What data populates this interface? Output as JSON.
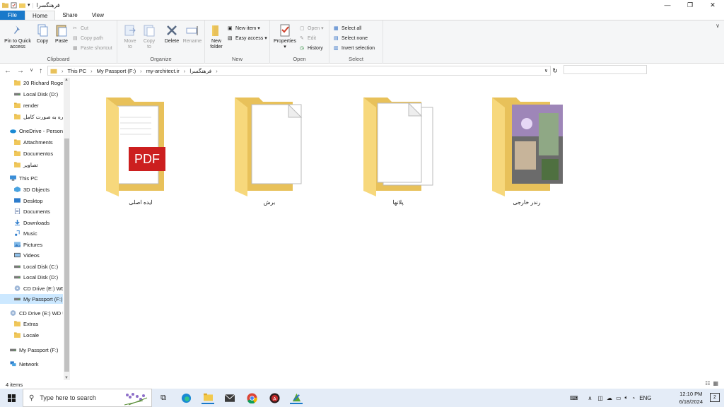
{
  "window": {
    "title": "فرهنگسرا",
    "controls": {
      "minimize": "—",
      "maximize": "❐",
      "close": "✕"
    }
  },
  "ribbon_tabs": [
    "File",
    "Home",
    "Share",
    "View"
  ],
  "ribbon": {
    "clipboard": {
      "label": "Clipboard",
      "pin": "Pin to Quick access",
      "copy": "Copy",
      "paste": "Paste",
      "cut": "Cut",
      "copy_path": "Copy path",
      "paste_shortcut": "Paste shortcut"
    },
    "organize": {
      "label": "Organize",
      "move_to": "Move to",
      "copy_to": "Copy to",
      "delete": "Delete",
      "rename": "Rename"
    },
    "new": {
      "label": "New",
      "new_folder": "New folder",
      "new_item": "New item",
      "easy_access": "Easy access"
    },
    "open": {
      "label": "Open",
      "properties": "Properties",
      "open": "Open",
      "edit": "Edit",
      "history": "History"
    },
    "select": {
      "label": "Select",
      "select_all": "Select all",
      "select_none": "Select none",
      "invert": "Invert selection"
    }
  },
  "address": {
    "crumbs": [
      "This PC",
      "My Passport (F:)",
      "my-architect.ir",
      "فرهنگسرا"
    ]
  },
  "navpane": [
    {
      "label": "20 Richard Roge",
      "icon": "folder"
    },
    {
      "label": "Local Disk (D:)",
      "icon": "drive"
    },
    {
      "label": "render",
      "icon": "folder"
    },
    {
      "label": "ره به صورت کامل",
      "icon": "folder"
    },
    {
      "label": "OneDrive - Person",
      "icon": "cloud"
    },
    {
      "label": "Attachments",
      "icon": "folder"
    },
    {
      "label": "Documentos",
      "icon": "folder"
    },
    {
      "label": "تصاویر",
      "icon": "folder"
    },
    {
      "label": "This PC",
      "icon": "pc"
    },
    {
      "label": "3D Objects",
      "icon": "3d"
    },
    {
      "label": "Desktop",
      "icon": "desktop"
    },
    {
      "label": "Documents",
      "icon": "docs"
    },
    {
      "label": "Downloads",
      "icon": "download"
    },
    {
      "label": "Music",
      "icon": "music"
    },
    {
      "label": "Pictures",
      "icon": "pictures"
    },
    {
      "label": "Videos",
      "icon": "videos"
    },
    {
      "label": "Local Disk (C:)",
      "icon": "drive"
    },
    {
      "label": "Local Disk (D:)",
      "icon": "drive"
    },
    {
      "label": "CD Drive (E:) WD",
      "icon": "cd"
    },
    {
      "label": "My Passport (F:)",
      "icon": "drive",
      "selected": true
    },
    {
      "label": "CD Drive (E:) WD U",
      "icon": "cd"
    },
    {
      "label": "Extras",
      "icon": "folder"
    },
    {
      "label": "Locale",
      "icon": "folder"
    },
    {
      "label": "My Passport (F:)",
      "icon": "drive"
    },
    {
      "label": "Network",
      "icon": "network"
    }
  ],
  "folders": [
    {
      "name": "ایده اصلی",
      "preview": "pdf"
    },
    {
      "name": "برش",
      "preview": "blank"
    },
    {
      "name": "پلانها",
      "preview": "docs"
    },
    {
      "name": "رندر خارجی",
      "preview": "render"
    }
  ],
  "status": {
    "items": "4 items"
  },
  "taskbar": {
    "search_placeholder": "Type here to search",
    "lang": "ENG",
    "time": "12:10 PM",
    "date": "6/18/2024",
    "notifications": "2"
  },
  "colors": {
    "accent": "#1979ca",
    "folder_back": "#e8c15a",
    "folder_front": "#f7d87c",
    "selected": "#cce8ff",
    "taskbar": "#e4ecf7"
  }
}
